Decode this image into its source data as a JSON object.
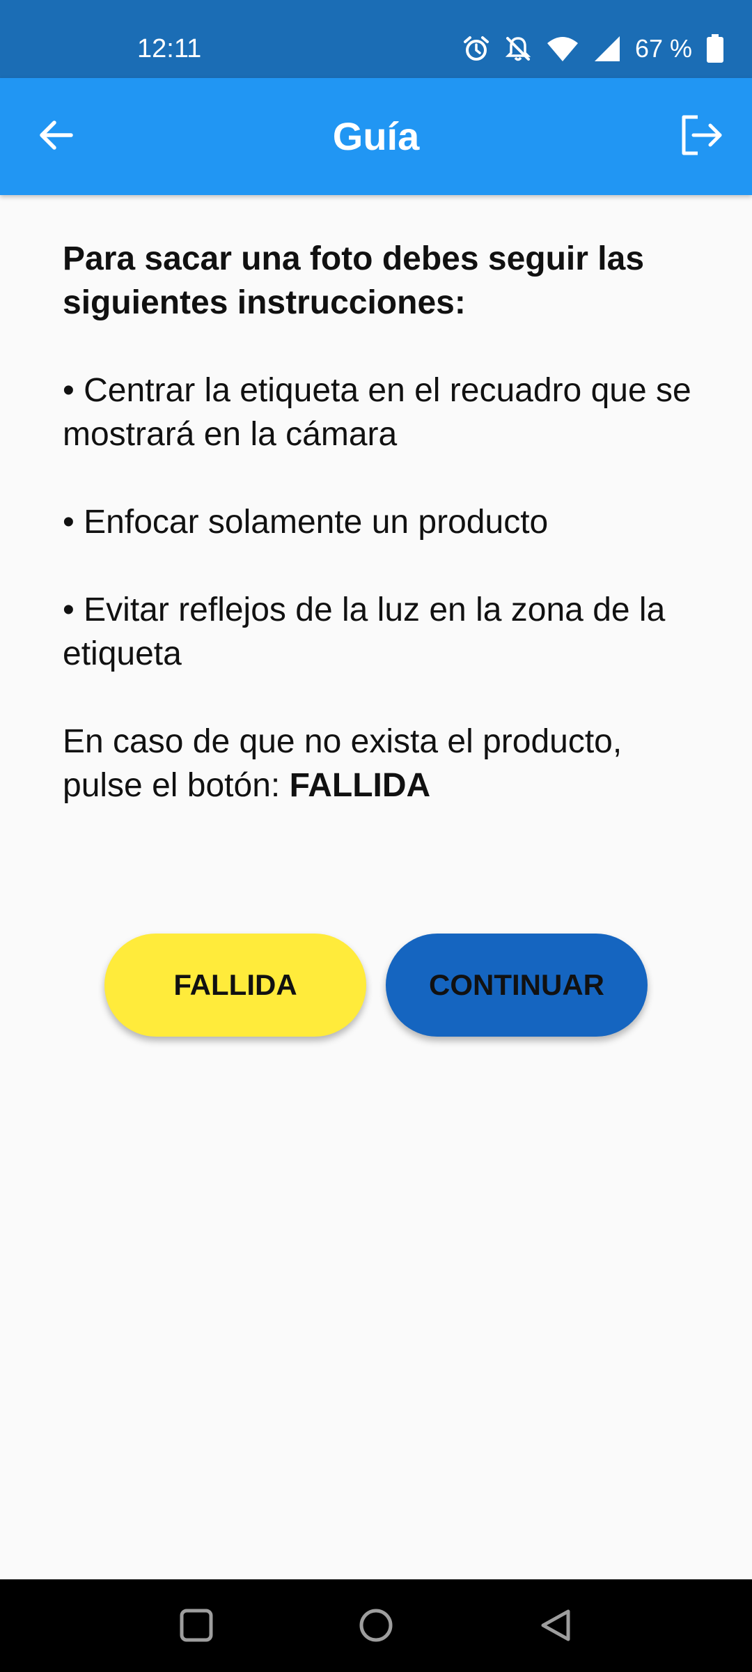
{
  "status_bar": {
    "time": "12:11",
    "battery": "67 %",
    "icons": [
      "alarm-icon",
      "notifications-off-icon",
      "wifi-icon",
      "signal-icon",
      "battery-icon"
    ]
  },
  "app_bar": {
    "title": "Guía",
    "back_icon": "arrow-left-icon",
    "logout_icon": "logout-icon",
    "color": "#2196f3"
  },
  "guide": {
    "heading": "Para sacar una foto debes seguir las siguientes instrucciones:",
    "bullets": [
      "• Centrar la etiqueta en el recuadro que se mostrará en la cámara",
      "• Enfocar solamente un producto",
      "• Evitar reflejos de la luz en la zona de la etiqueta"
    ],
    "note_prefix": "En caso de que no exista el producto, pulse el botón: ",
    "note_emphasis": "FALLIDA"
  },
  "buttons": {
    "fallida": {
      "label": "FALLIDA",
      "color": "#ffeb3b"
    },
    "continuar": {
      "label": "CONTINUAR",
      "color": "#1565c0"
    }
  },
  "nav_bar": {
    "icons": [
      "recents-square-icon",
      "home-circle-icon",
      "back-triangle-icon"
    ]
  }
}
